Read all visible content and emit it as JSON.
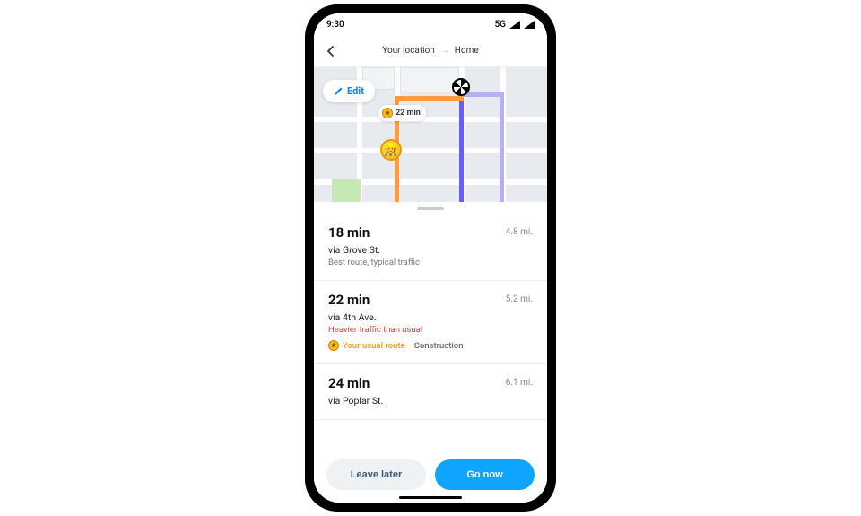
{
  "status": {
    "time": "9:30",
    "network": "5G"
  },
  "header": {
    "from": "Your location",
    "to": "Home"
  },
  "map": {
    "edit_label": "Edit",
    "badge_time": "22 min"
  },
  "routes": [
    {
      "time": "18 min",
      "via": "via Grove St.",
      "sub": "Best route, typical traffic",
      "distance": "4.8 mi."
    },
    {
      "time": "22 min",
      "via": "via 4th Ave.",
      "warning": "Heavier traffic than usual",
      "usual_label": "Your usual route",
      "construction_label": "Construction",
      "distance": "5.2 mi."
    },
    {
      "time": "24 min",
      "via": "via Poplar St.",
      "distance": "6.1 mi."
    }
  ],
  "footer": {
    "leave_later": "Leave later",
    "go_now": "Go now"
  }
}
